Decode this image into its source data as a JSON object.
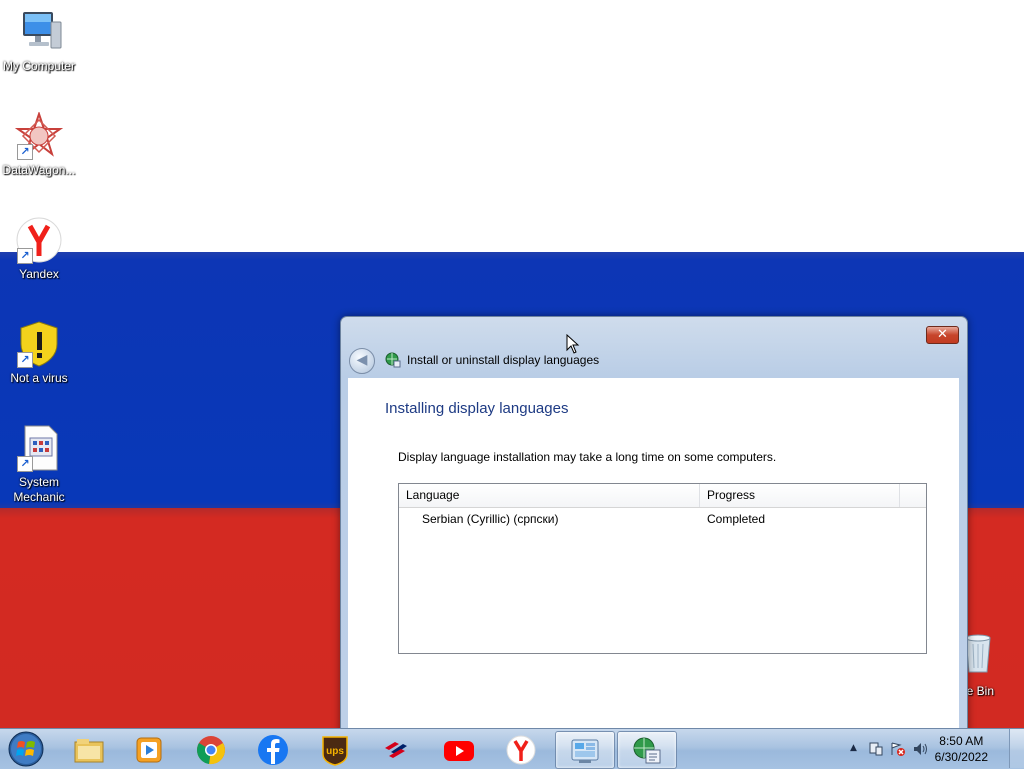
{
  "desktop": {
    "icons": [
      {
        "label": "My Computer"
      },
      {
        "label": "DataWagon..."
      },
      {
        "label": "Yandex"
      },
      {
        "label": "Not a virus"
      },
      {
        "label": "System\nMechanic"
      }
    ],
    "recycle_bin": {
      "label": "ycle Bin"
    }
  },
  "window": {
    "title": "Install or uninstall display languages",
    "close_label": "✕",
    "back_label": "◀",
    "heading": "Installing display languages",
    "info": "Display language installation may take a long time on some computers.",
    "list": {
      "columns": [
        "Language",
        "Progress"
      ],
      "rows": [
        {
          "language": "Serbian (Cyrillic) (српски)",
          "progress": "Completed"
        }
      ]
    }
  },
  "taskbar": {
    "time": "8:50 AM",
    "date": "6/30/2022",
    "tray_up": "▲"
  }
}
